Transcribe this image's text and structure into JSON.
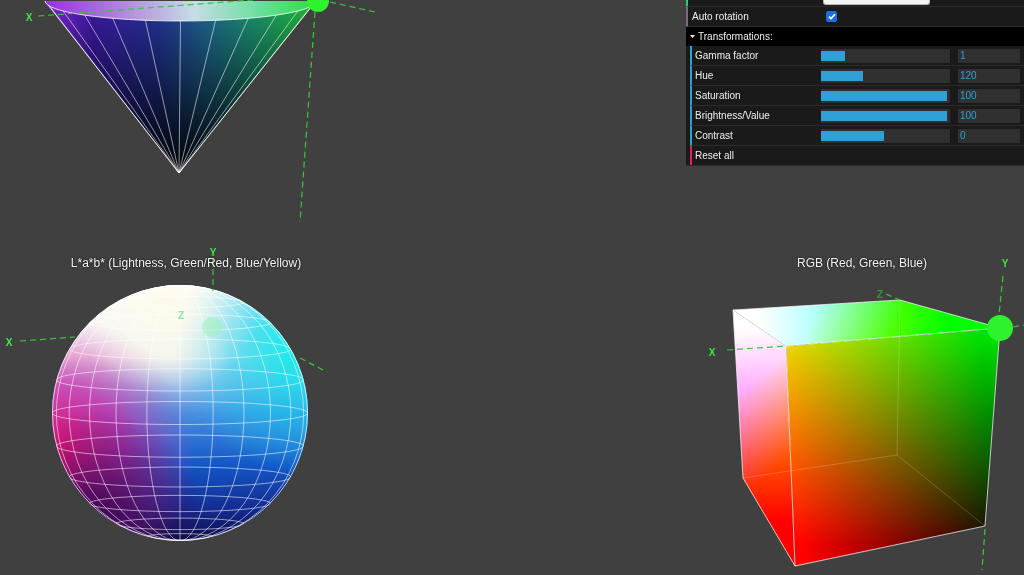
{
  "gui": {
    "rows": [
      {
        "kind": "select"
      },
      {
        "kind": "checkbox",
        "label": "Auto rotation",
        "checked": true
      },
      {
        "kind": "folder",
        "label": "Transformations:",
        "expanded": true,
        "children": [
          {
            "kind": "slider",
            "label": "Gamma factor",
            "level": 0.19,
            "value": "1"
          },
          {
            "kind": "slider",
            "label": "Hue",
            "level": 0.33,
            "value": "120"
          },
          {
            "kind": "slider",
            "label": "Saturation",
            "level": 1,
            "value": "100"
          },
          {
            "kind": "slider",
            "label": "Brightness/Value",
            "level": 1,
            "value": "100"
          },
          {
            "kind": "slider",
            "label": "Contrast",
            "level": 0.5,
            "value": "0"
          },
          {
            "kind": "button",
            "label": "Reset all"
          }
        ]
      }
    ]
  },
  "views": [
    {
      "kind": "cone",
      "axes": [
        {
          "label": "X"
        }
      ]
    },
    {
      "kind": "sphere",
      "title": "L*a*b* (Lightness, Green/Red, Blue/Yellow)",
      "axes": [
        {
          "label": "X"
        },
        {
          "label": "Y"
        },
        {
          "label": "Z"
        }
      ]
    },
    {
      "kind": "cube",
      "title": "RGB (Red, Green, Blue)",
      "axes": [
        {
          "label": "X"
        },
        {
          "label": "Y"
        },
        {
          "label": "Z"
        }
      ]
    }
  ]
}
